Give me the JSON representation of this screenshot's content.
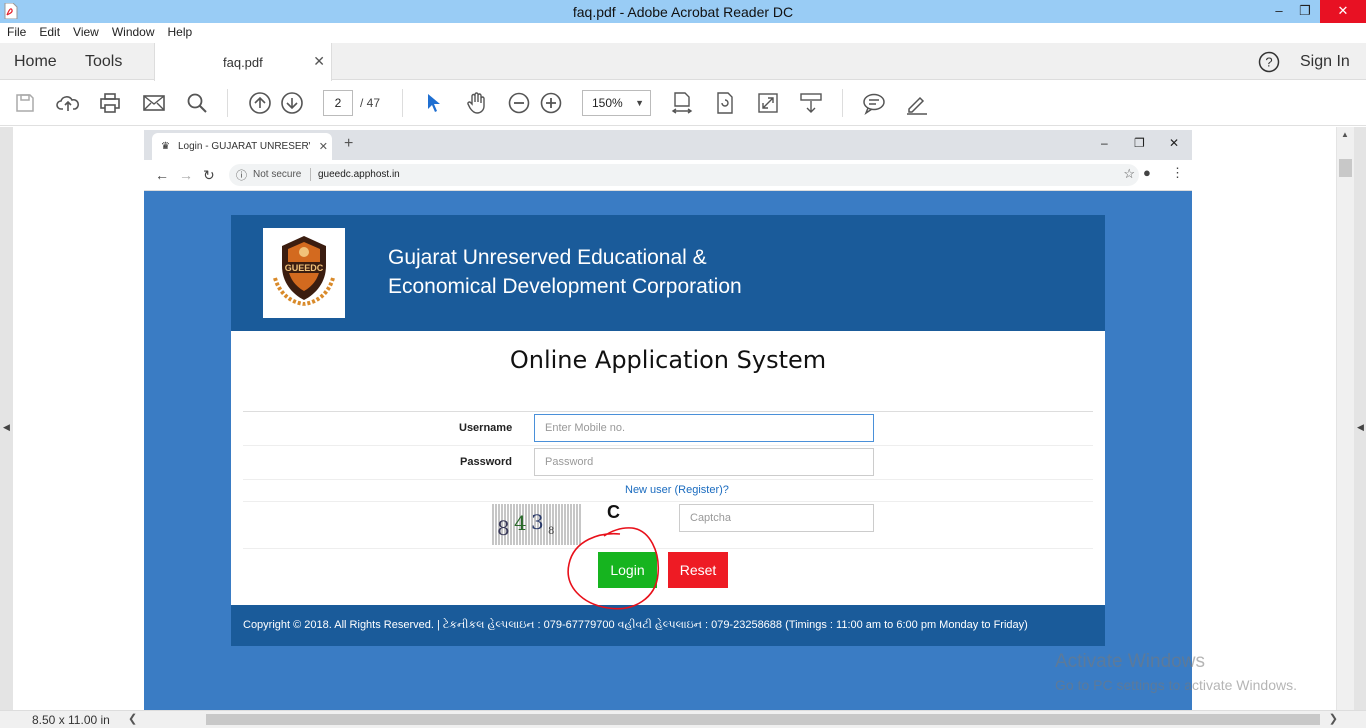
{
  "window": {
    "title": "faq.pdf - Adobe Acrobat Reader DC"
  },
  "menu": [
    "File",
    "Edit",
    "View",
    "Window",
    "Help"
  ],
  "tabs": {
    "home": "Home",
    "tools": "Tools",
    "document": "faq.pdf",
    "sign_in": "Sign In"
  },
  "toolbar": {
    "page_current": "2",
    "page_total": "/ 47",
    "zoom": "150%",
    "icons": [
      "save-icon",
      "upload-icon",
      "print-icon",
      "email-icon",
      "search-icon",
      "page-up-icon",
      "page-down-icon",
      "select-cursor-icon",
      "hand-icon",
      "zoom-out-icon",
      "zoom-in-icon",
      "fit-page-icon",
      "rotate-icon",
      "fullscreen-icon",
      "scroll-mode-icon",
      "comment-icon",
      "sign-icon"
    ]
  },
  "status": {
    "page_size": "8.50 x 11.00 in"
  },
  "browser": {
    "tab_title": "Login - GUJARAT UNRESERVED E",
    "security": "Not secure",
    "url": "gueedc.apphost.in"
  },
  "site": {
    "logo_text": "GUEEDC",
    "org_line1": "Gujarat Unreserved Educational &",
    "org_line2": "Economical Development Corporation",
    "system_title": "Online Application System",
    "username_label": "Username",
    "username_placeholder": "Enter Mobile no.",
    "password_label": "Password",
    "password_placeholder": "Password",
    "register_link": "New user (Register)?",
    "captcha_chars": [
      "8",
      "4",
      "3",
      "8"
    ],
    "refresh_glyph": "C",
    "captcha_placeholder": "Captcha",
    "login_label": "Login",
    "reset_label": "Reset",
    "footer": "Copyright © 2018. All Rights Reserved.  | ટેકનીકલ હેલ્પલાઇન : 079-67779700 વહીવટી હેલ્પલાઇન : 079-23258688 (Timings : 11:00 am to 6:00 pm Monday to Friday)"
  },
  "watermark": {
    "heading": "Activate Windows",
    "sub": "Go to PC settings to activate Windows."
  },
  "colors": {
    "titlebar": "#99ccf5",
    "site_header": "#1a5b9a",
    "login": "#16b41f",
    "reset": "#ee1b24",
    "annotation": "#e8101a"
  }
}
